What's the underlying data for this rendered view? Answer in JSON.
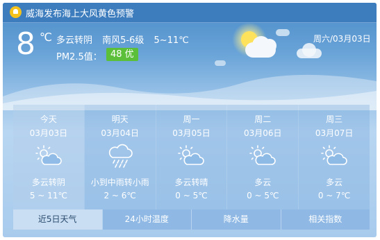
{
  "alert": {
    "text": "威海发布海上大风黄色预警",
    "icon": "alert-bell-icon"
  },
  "current": {
    "temp": "8",
    "unit": "℃",
    "condition": "多云转阴",
    "wind": "南风5-6级",
    "range": "5~11℃",
    "pm_label": "PM2.5值：",
    "pm_value": "48 优",
    "date": "周六/03月03日"
  },
  "forecast": [
    {
      "name": "今天",
      "date": "03月03日",
      "icon": "partly-cloudy-icon",
      "condition": "多云转阴",
      "range": "5 ~ 11℃"
    },
    {
      "name": "明天",
      "date": "03月04日",
      "icon": "rain-icon",
      "condition": "小到中雨转小雨",
      "range": "2 ~ 6℃"
    },
    {
      "name": "周一",
      "date": "03月05日",
      "icon": "partly-cloudy-icon",
      "condition": "多云转晴",
      "range": "0 ~ 5℃"
    },
    {
      "name": "周二",
      "date": "03月06日",
      "icon": "partly-cloudy-icon",
      "condition": "多云",
      "range": "0 ~ 5℃"
    },
    {
      "name": "周三",
      "date": "03月07日",
      "icon": "partly-cloudy-icon",
      "condition": "多云",
      "range": "0 ~ 7℃"
    }
  ],
  "tabs": [
    "近5日天气",
    "24小时温度",
    "降水量",
    "相关指数"
  ]
}
